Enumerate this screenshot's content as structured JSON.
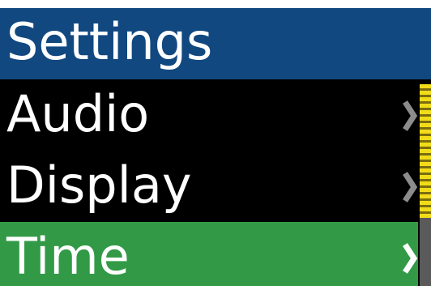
{
  "header": {
    "title": "Settings"
  },
  "menu": {
    "items": [
      {
        "label": "Audio",
        "icon": "chevron-right-icon",
        "selected": false
      },
      {
        "label": "Display",
        "icon": "chevron-right-icon",
        "selected": false
      },
      {
        "label": "Time",
        "icon": "chevron-right-icon",
        "selected": true
      }
    ]
  },
  "scroll": {
    "position_fraction": 0.0,
    "visible_fraction": 0.66
  },
  "colors": {
    "header_bg": "#124880",
    "selected_bg": "#329a46",
    "screen_bg": "#000000",
    "text": "#ffffff",
    "chevron": "#8c8c8c",
    "chevron_selected": "#ffffff",
    "scroll_thumb": "#f2dc1a",
    "scroll_track": "#5a5a5a"
  }
}
